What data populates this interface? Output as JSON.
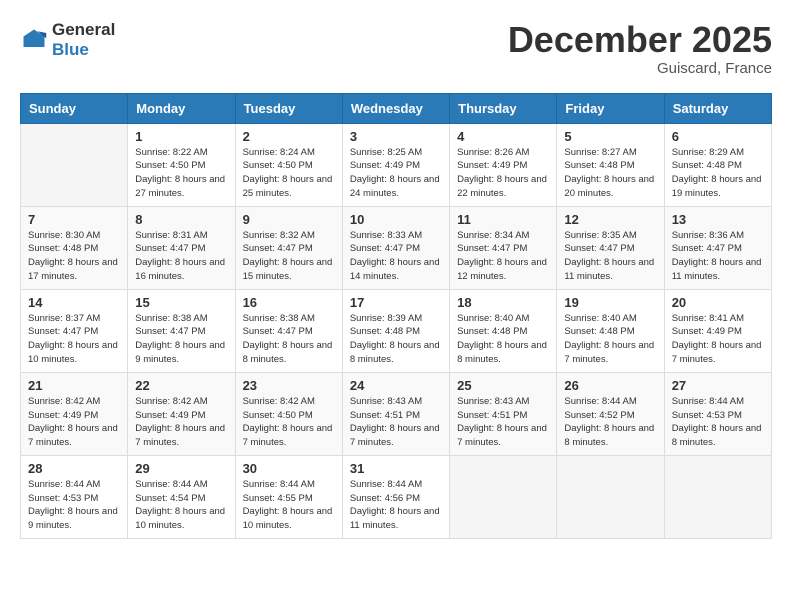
{
  "header": {
    "logo_general": "General",
    "logo_blue": "Blue",
    "month": "December 2025",
    "location": "Guiscard, France"
  },
  "days_of_week": [
    "Sunday",
    "Monday",
    "Tuesday",
    "Wednesday",
    "Thursday",
    "Friday",
    "Saturday"
  ],
  "weeks": [
    [
      {
        "day": "",
        "sunrise": "",
        "sunset": "",
        "daylight": ""
      },
      {
        "day": "1",
        "sunrise": "Sunrise: 8:22 AM",
        "sunset": "Sunset: 4:50 PM",
        "daylight": "Daylight: 8 hours and 27 minutes."
      },
      {
        "day": "2",
        "sunrise": "Sunrise: 8:24 AM",
        "sunset": "Sunset: 4:50 PM",
        "daylight": "Daylight: 8 hours and 25 minutes."
      },
      {
        "day": "3",
        "sunrise": "Sunrise: 8:25 AM",
        "sunset": "Sunset: 4:49 PM",
        "daylight": "Daylight: 8 hours and 24 minutes."
      },
      {
        "day": "4",
        "sunrise": "Sunrise: 8:26 AM",
        "sunset": "Sunset: 4:49 PM",
        "daylight": "Daylight: 8 hours and 22 minutes."
      },
      {
        "day": "5",
        "sunrise": "Sunrise: 8:27 AM",
        "sunset": "Sunset: 4:48 PM",
        "daylight": "Daylight: 8 hours and 20 minutes."
      },
      {
        "day": "6",
        "sunrise": "Sunrise: 8:29 AM",
        "sunset": "Sunset: 4:48 PM",
        "daylight": "Daylight: 8 hours and 19 minutes."
      }
    ],
    [
      {
        "day": "7",
        "sunrise": "Sunrise: 8:30 AM",
        "sunset": "Sunset: 4:48 PM",
        "daylight": "Daylight: 8 hours and 17 minutes."
      },
      {
        "day": "8",
        "sunrise": "Sunrise: 8:31 AM",
        "sunset": "Sunset: 4:47 PM",
        "daylight": "Daylight: 8 hours and 16 minutes."
      },
      {
        "day": "9",
        "sunrise": "Sunrise: 8:32 AM",
        "sunset": "Sunset: 4:47 PM",
        "daylight": "Daylight: 8 hours and 15 minutes."
      },
      {
        "day": "10",
        "sunrise": "Sunrise: 8:33 AM",
        "sunset": "Sunset: 4:47 PM",
        "daylight": "Daylight: 8 hours and 14 minutes."
      },
      {
        "day": "11",
        "sunrise": "Sunrise: 8:34 AM",
        "sunset": "Sunset: 4:47 PM",
        "daylight": "Daylight: 8 hours and 12 minutes."
      },
      {
        "day": "12",
        "sunrise": "Sunrise: 8:35 AM",
        "sunset": "Sunset: 4:47 PM",
        "daylight": "Daylight: 8 hours and 11 minutes."
      },
      {
        "day": "13",
        "sunrise": "Sunrise: 8:36 AM",
        "sunset": "Sunset: 4:47 PM",
        "daylight": "Daylight: 8 hours and 11 minutes."
      }
    ],
    [
      {
        "day": "14",
        "sunrise": "Sunrise: 8:37 AM",
        "sunset": "Sunset: 4:47 PM",
        "daylight": "Daylight: 8 hours and 10 minutes."
      },
      {
        "day": "15",
        "sunrise": "Sunrise: 8:38 AM",
        "sunset": "Sunset: 4:47 PM",
        "daylight": "Daylight: 8 hours and 9 minutes."
      },
      {
        "day": "16",
        "sunrise": "Sunrise: 8:38 AM",
        "sunset": "Sunset: 4:47 PM",
        "daylight": "Daylight: 8 hours and 8 minutes."
      },
      {
        "day": "17",
        "sunrise": "Sunrise: 8:39 AM",
        "sunset": "Sunset: 4:48 PM",
        "daylight": "Daylight: 8 hours and 8 minutes."
      },
      {
        "day": "18",
        "sunrise": "Sunrise: 8:40 AM",
        "sunset": "Sunset: 4:48 PM",
        "daylight": "Daylight: 8 hours and 8 minutes."
      },
      {
        "day": "19",
        "sunrise": "Sunrise: 8:40 AM",
        "sunset": "Sunset: 4:48 PM",
        "daylight": "Daylight: 8 hours and 7 minutes."
      },
      {
        "day": "20",
        "sunrise": "Sunrise: 8:41 AM",
        "sunset": "Sunset: 4:49 PM",
        "daylight": "Daylight: 8 hours and 7 minutes."
      }
    ],
    [
      {
        "day": "21",
        "sunrise": "Sunrise: 8:42 AM",
        "sunset": "Sunset: 4:49 PM",
        "daylight": "Daylight: 8 hours and 7 minutes."
      },
      {
        "day": "22",
        "sunrise": "Sunrise: 8:42 AM",
        "sunset": "Sunset: 4:49 PM",
        "daylight": "Daylight: 8 hours and 7 minutes."
      },
      {
        "day": "23",
        "sunrise": "Sunrise: 8:42 AM",
        "sunset": "Sunset: 4:50 PM",
        "daylight": "Daylight: 8 hours and 7 minutes."
      },
      {
        "day": "24",
        "sunrise": "Sunrise: 8:43 AM",
        "sunset": "Sunset: 4:51 PM",
        "daylight": "Daylight: 8 hours and 7 minutes."
      },
      {
        "day": "25",
        "sunrise": "Sunrise: 8:43 AM",
        "sunset": "Sunset: 4:51 PM",
        "daylight": "Daylight: 8 hours and 7 minutes."
      },
      {
        "day": "26",
        "sunrise": "Sunrise: 8:44 AM",
        "sunset": "Sunset: 4:52 PM",
        "daylight": "Daylight: 8 hours and 8 minutes."
      },
      {
        "day": "27",
        "sunrise": "Sunrise: 8:44 AM",
        "sunset": "Sunset: 4:53 PM",
        "daylight": "Daylight: 8 hours and 8 minutes."
      }
    ],
    [
      {
        "day": "28",
        "sunrise": "Sunrise: 8:44 AM",
        "sunset": "Sunset: 4:53 PM",
        "daylight": "Daylight: 8 hours and 9 minutes."
      },
      {
        "day": "29",
        "sunrise": "Sunrise: 8:44 AM",
        "sunset": "Sunset: 4:54 PM",
        "daylight": "Daylight: 8 hours and 10 minutes."
      },
      {
        "day": "30",
        "sunrise": "Sunrise: 8:44 AM",
        "sunset": "Sunset: 4:55 PM",
        "daylight": "Daylight: 8 hours and 10 minutes."
      },
      {
        "day": "31",
        "sunrise": "Sunrise: 8:44 AM",
        "sunset": "Sunset: 4:56 PM",
        "daylight": "Daylight: 8 hours and 11 minutes."
      },
      {
        "day": "",
        "sunrise": "",
        "sunset": "",
        "daylight": ""
      },
      {
        "day": "",
        "sunrise": "",
        "sunset": "",
        "daylight": ""
      },
      {
        "day": "",
        "sunrise": "",
        "sunset": "",
        "daylight": ""
      }
    ]
  ]
}
